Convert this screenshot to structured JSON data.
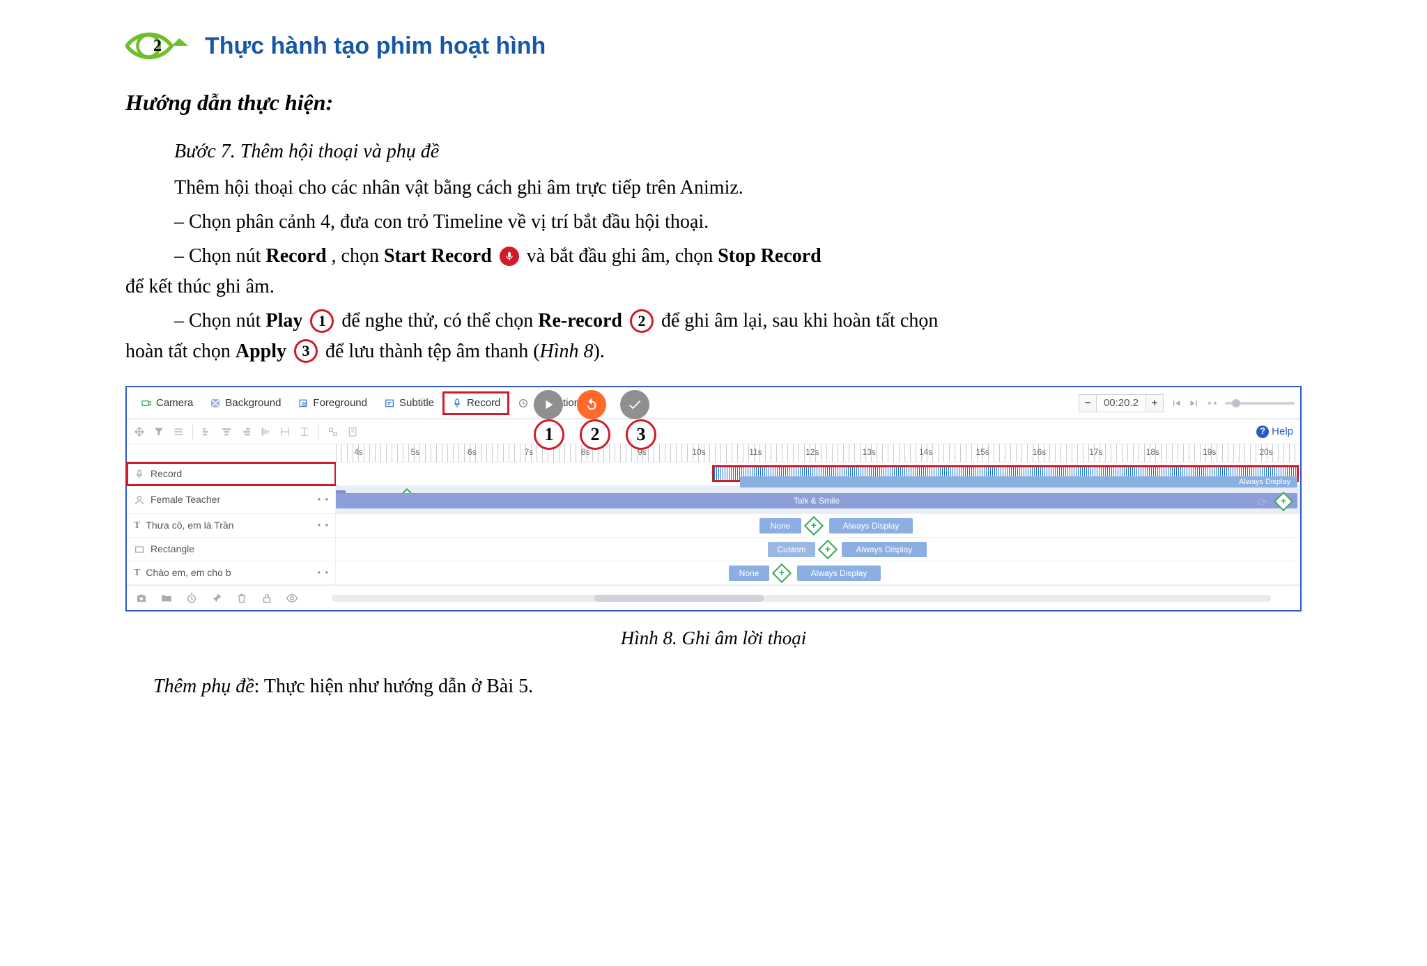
{
  "bullet": {
    "number": "2"
  },
  "title": "Thực hành tạo phim hoạt hình",
  "subheading": "Hướng dẫn thực hiện:",
  "step_title": "Bước 7. Thêm hội thoại và phụ đề",
  "p_intro": "Thêm hội thoại cho các nhân vật bằng cách ghi âm trực tiếp trên Animiz.",
  "dash1": "– Chọn phân cảnh 4, đưa con trỏ Timeline về vị trí bắt đầu hội thoại.",
  "dash2_a": "– Chọn nút ",
  "dash2_record_label": "Record",
  "dash2_b": ", chọn ",
  "dash2_start_label": "Start Record",
  "dash2_c": " và bắt đầu ghi âm, chọn ",
  "dash2_stop_label": "Stop Record",
  "dash2_d": " để kết thúc ghi âm.",
  "dash3_a": "– Chọn nút ",
  "dash3_play_label": "Play",
  "dash3_b": " để nghe thử, có thể chọn ",
  "dash3_rerecord_label": "Re-record",
  "dash3_c": " để ghi âm lại, sau khi hoàn tất chọn ",
  "dash3_apply_label": "Apply",
  "dash3_d": " để lưu thành tệp âm thanh (",
  "dash3_figref": "Hình 8",
  "dash3_e": ").",
  "circle1": "1",
  "circle2": "2",
  "circle3": "3",
  "app": {
    "tabs": {
      "camera": "Camera",
      "background": "Background",
      "foreground": "Foreground",
      "subtitle": "Subtitle",
      "record": "Record",
      "anim": "Animation Du"
    },
    "zoom_value": "00:20.2",
    "help": "Help",
    "ruler_ticks": [
      "4s",
      "5s",
      "6s",
      "7s",
      "8s",
      "9s",
      "10s",
      "11s",
      "12s",
      "13s",
      "14s",
      "15s",
      "16s",
      "17s",
      "18s",
      "19s",
      "20s"
    ],
    "tracks": {
      "record": "Record",
      "female_teacher": "Female Teacher",
      "text1": "Thưa cô, em là Trần",
      "rectangle": "Rectangle",
      "text2": "Chào em, em cho b"
    },
    "bars": {
      "talk_smile": "Talk & Smile",
      "always_display": "Always Display",
      "none": "None",
      "custom": "Custom"
    }
  },
  "fig_caption": "Hình 8. Ghi âm lời thoại",
  "last_label": "Thêm phụ đề",
  "last_text": ": Thực hiện như hướng dẫn ở Bài 5."
}
